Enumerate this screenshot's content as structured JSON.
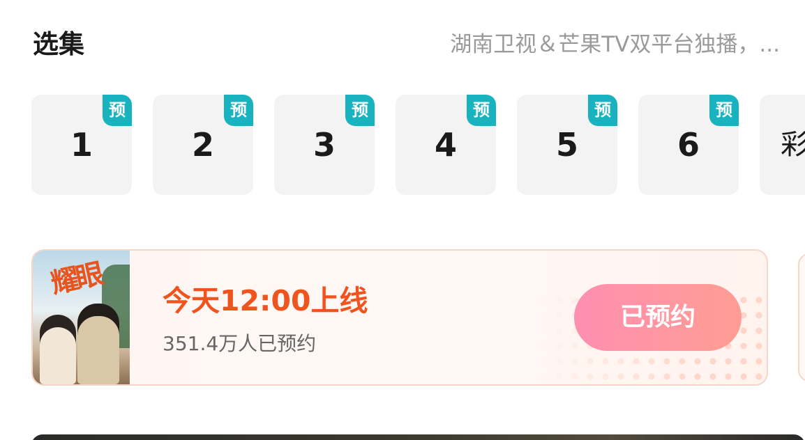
{
  "section": {
    "title": "选集",
    "subtitle": "湖南卫视＆芒果TV双平台独播，..."
  },
  "episodes": [
    {
      "label": "1",
      "badge": "预"
    },
    {
      "label": "2",
      "badge": "预"
    },
    {
      "label": "3",
      "badge": "预"
    },
    {
      "label": "4",
      "badge": "预"
    },
    {
      "label": "5",
      "badge": "预"
    },
    {
      "label": "6",
      "badge": "预"
    },
    {
      "label": "彩"
    }
  ],
  "reservation": {
    "poster_title": "耀眼",
    "release_time": "今天12:00上线",
    "reserved_count": "351.4万人已预约",
    "button_label": "已预约"
  },
  "colors": {
    "badge": "#19b3bf",
    "accent_orange": "#f0541e",
    "button_gradient_start": "#ff8fb0",
    "button_gradient_end": "#ff9d94"
  }
}
